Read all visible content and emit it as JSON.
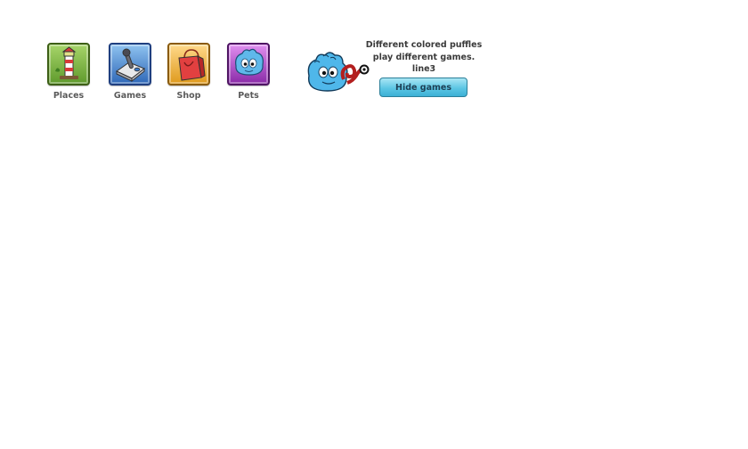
{
  "nav": {
    "items": [
      {
        "label": "Places",
        "icon": "lighthouse-icon",
        "color": "#6aa33a"
      },
      {
        "label": "Games",
        "icon": "joystick-icon",
        "color": "#3f7fc8"
      },
      {
        "label": "Shop",
        "icon": "shopping-bag-icon",
        "color": "#e8a833"
      },
      {
        "label": "Pets",
        "icon": "puffle-icon",
        "color": "#9b3fb6"
      }
    ]
  },
  "info": {
    "lines": [
      "Different colored puffles",
      "play different games.",
      "line3"
    ],
    "button_label": "Hide games",
    "puffle_icon": "blue-puffle-icon",
    "toy_icon": "red-toy-icon"
  }
}
